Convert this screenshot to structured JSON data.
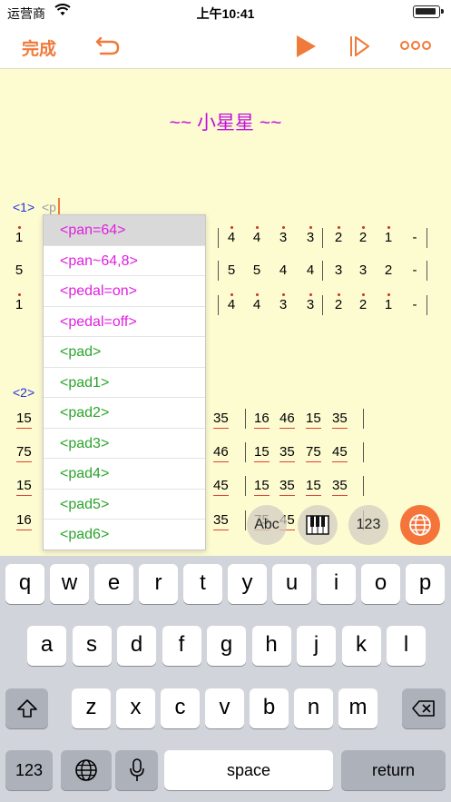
{
  "status": {
    "carrier": "运营商",
    "time": "上午10:41",
    "battery_level": 0.9
  },
  "toolbar": {
    "done_label": "完成",
    "undo": "undo-icon",
    "play": "play-icon",
    "step": "step-play-icon",
    "more": "more-icon"
  },
  "editor": {
    "title": "~~ 小星星 ~~",
    "section1_label": "<1>",
    "typing_text": "<p",
    "section2_label": "<2>",
    "rows1": [
      {
        "lead": "1",
        "notes": [
          "4",
          "4",
          "3",
          "3",
          "2",
          "2",
          "1",
          "-"
        ]
      },
      {
        "lead": "5",
        "notes": [
          "5",
          "5",
          "4",
          "4",
          "3",
          "3",
          "2",
          "-"
        ]
      },
      {
        "lead": "1",
        "notes": [
          "4",
          "4",
          "3",
          "3",
          "2",
          "2",
          "1",
          "-"
        ]
      }
    ],
    "rows2": [
      {
        "lead": "15",
        "tail_a": "35",
        "tail_b": [
          "16",
          "46",
          "15",
          "35"
        ]
      },
      {
        "lead": "75",
        "tail_a": "46",
        "tail_b": [
          "15",
          "35",
          "75",
          "45"
        ]
      },
      {
        "lead": "15",
        "tail_a": "45",
        "tail_b": [
          "15",
          "35",
          "15",
          "35"
        ]
      },
      {
        "lead": "16",
        "tail_a": "35",
        "tail_b": [
          "75",
          "45",
          "",
          ""
        ]
      }
    ]
  },
  "autocomplete": {
    "items": [
      {
        "label": "<pan=64>",
        "color": "#e020e0"
      },
      {
        "label": "<pan~64,8>",
        "color": "#e020e0"
      },
      {
        "label": "<pedal=on>",
        "color": "#e020e0"
      },
      {
        "label": "<pedal=off>",
        "color": "#e020e0"
      },
      {
        "label": "<pad>",
        "color": "#2aa52a"
      },
      {
        "label": "<pad1>",
        "color": "#2aa52a"
      },
      {
        "label": "<pad2>",
        "color": "#2aa52a"
      },
      {
        "label": "<pad3>",
        "color": "#2aa52a"
      },
      {
        "label": "<pad4>",
        "color": "#2aa52a"
      },
      {
        "label": "<pad5>",
        "color": "#2aa52a"
      },
      {
        "label": "<pad6>",
        "color": "#2aa52a"
      }
    ]
  },
  "input_modes": {
    "abc": "Abc",
    "num": "123",
    "piano": "piano-icon",
    "globe": "globe-icon"
  },
  "keyboard": {
    "row1": [
      "q",
      "w",
      "e",
      "r",
      "t",
      "y",
      "u",
      "i",
      "o",
      "p"
    ],
    "row2": [
      "a",
      "s",
      "d",
      "f",
      "g",
      "h",
      "j",
      "k",
      "l"
    ],
    "row3": [
      "z",
      "x",
      "c",
      "v",
      "b",
      "n",
      "m"
    ],
    "numbers": "123",
    "space": "space",
    "return": "return"
  },
  "colors": {
    "accent": "#f07a3a",
    "title": "#c010e0",
    "section_label": "#2030e0",
    "pad_green": "#2aa52a",
    "pan_magenta": "#e020e0"
  }
}
